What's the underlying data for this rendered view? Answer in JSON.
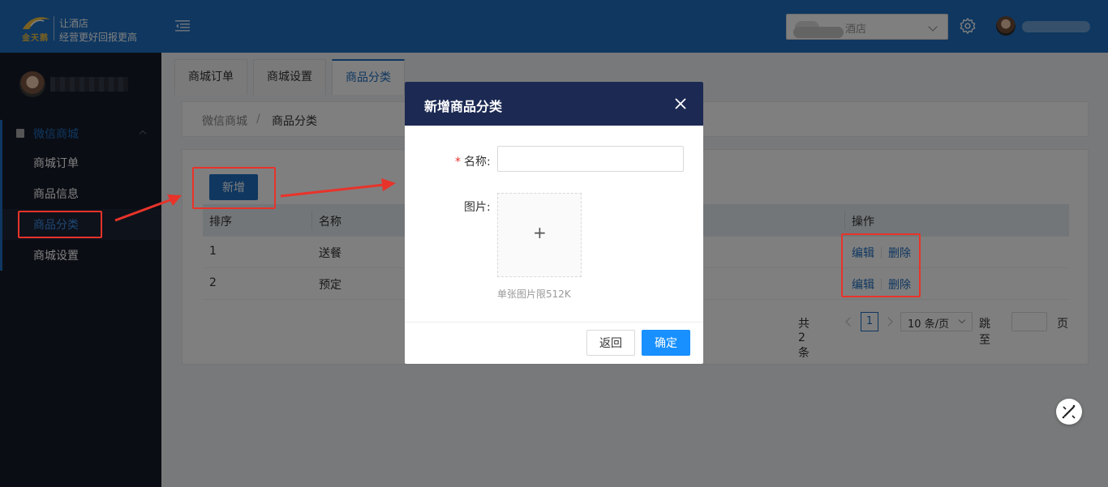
{
  "header": {
    "logo_text": "金天鹅",
    "slogan_line1": "让酒店",
    "slogan_line2": "经营更好回报更高",
    "hotel_select_value": "酒店"
  },
  "sidebar": {
    "group_title": "微信商城",
    "items": [
      {
        "label": "商城订单"
      },
      {
        "label": "商品信息"
      },
      {
        "label": "商品分类"
      },
      {
        "label": "商城设置"
      }
    ]
  },
  "tabs": [
    {
      "label": "商城订单"
    },
    {
      "label": "商城设置"
    },
    {
      "label": "商品分类"
    }
  ],
  "breadcrumb": {
    "parent": "微信商城",
    "separator": "/",
    "current": "商品分类"
  },
  "toolbar": {
    "add_label": "新增"
  },
  "table": {
    "columns": [
      "排序",
      "名称",
      "操作"
    ],
    "rows": [
      {
        "order": "1",
        "name": "送餐"
      },
      {
        "order": "2",
        "name": "预定"
      }
    ],
    "edit_label": "编辑",
    "delete_label": "删除"
  },
  "pagination": {
    "total_text": "共 2 条",
    "current_page": "1",
    "page_size": "10 条/页",
    "jump_label": "跳至",
    "jump_unit": "页"
  },
  "modal": {
    "title": "新增商品分类",
    "name_label": "名称:",
    "required_mark": "*",
    "name_value": "",
    "image_label": "图片:",
    "upload_plus": "+",
    "upload_hint": "单张图片限512K",
    "back_label": "返回",
    "confirm_label": "确定"
  },
  "colors": {
    "primary": "#1f6fc0",
    "header_bg": "#1f6fc0",
    "sidebar_bg": "#161b29",
    "modal_header_bg": "#1c2a53",
    "confirm_button": "#1890ff",
    "annotation_red": "#e8332a"
  },
  "icons": [
    "logo-icon",
    "menu-collapse-icon",
    "chevron-down-icon",
    "settings-icon",
    "avatar",
    "book-icon",
    "chevron-up-icon",
    "close-icon",
    "plus-icon",
    "magic-wand-icon"
  ]
}
